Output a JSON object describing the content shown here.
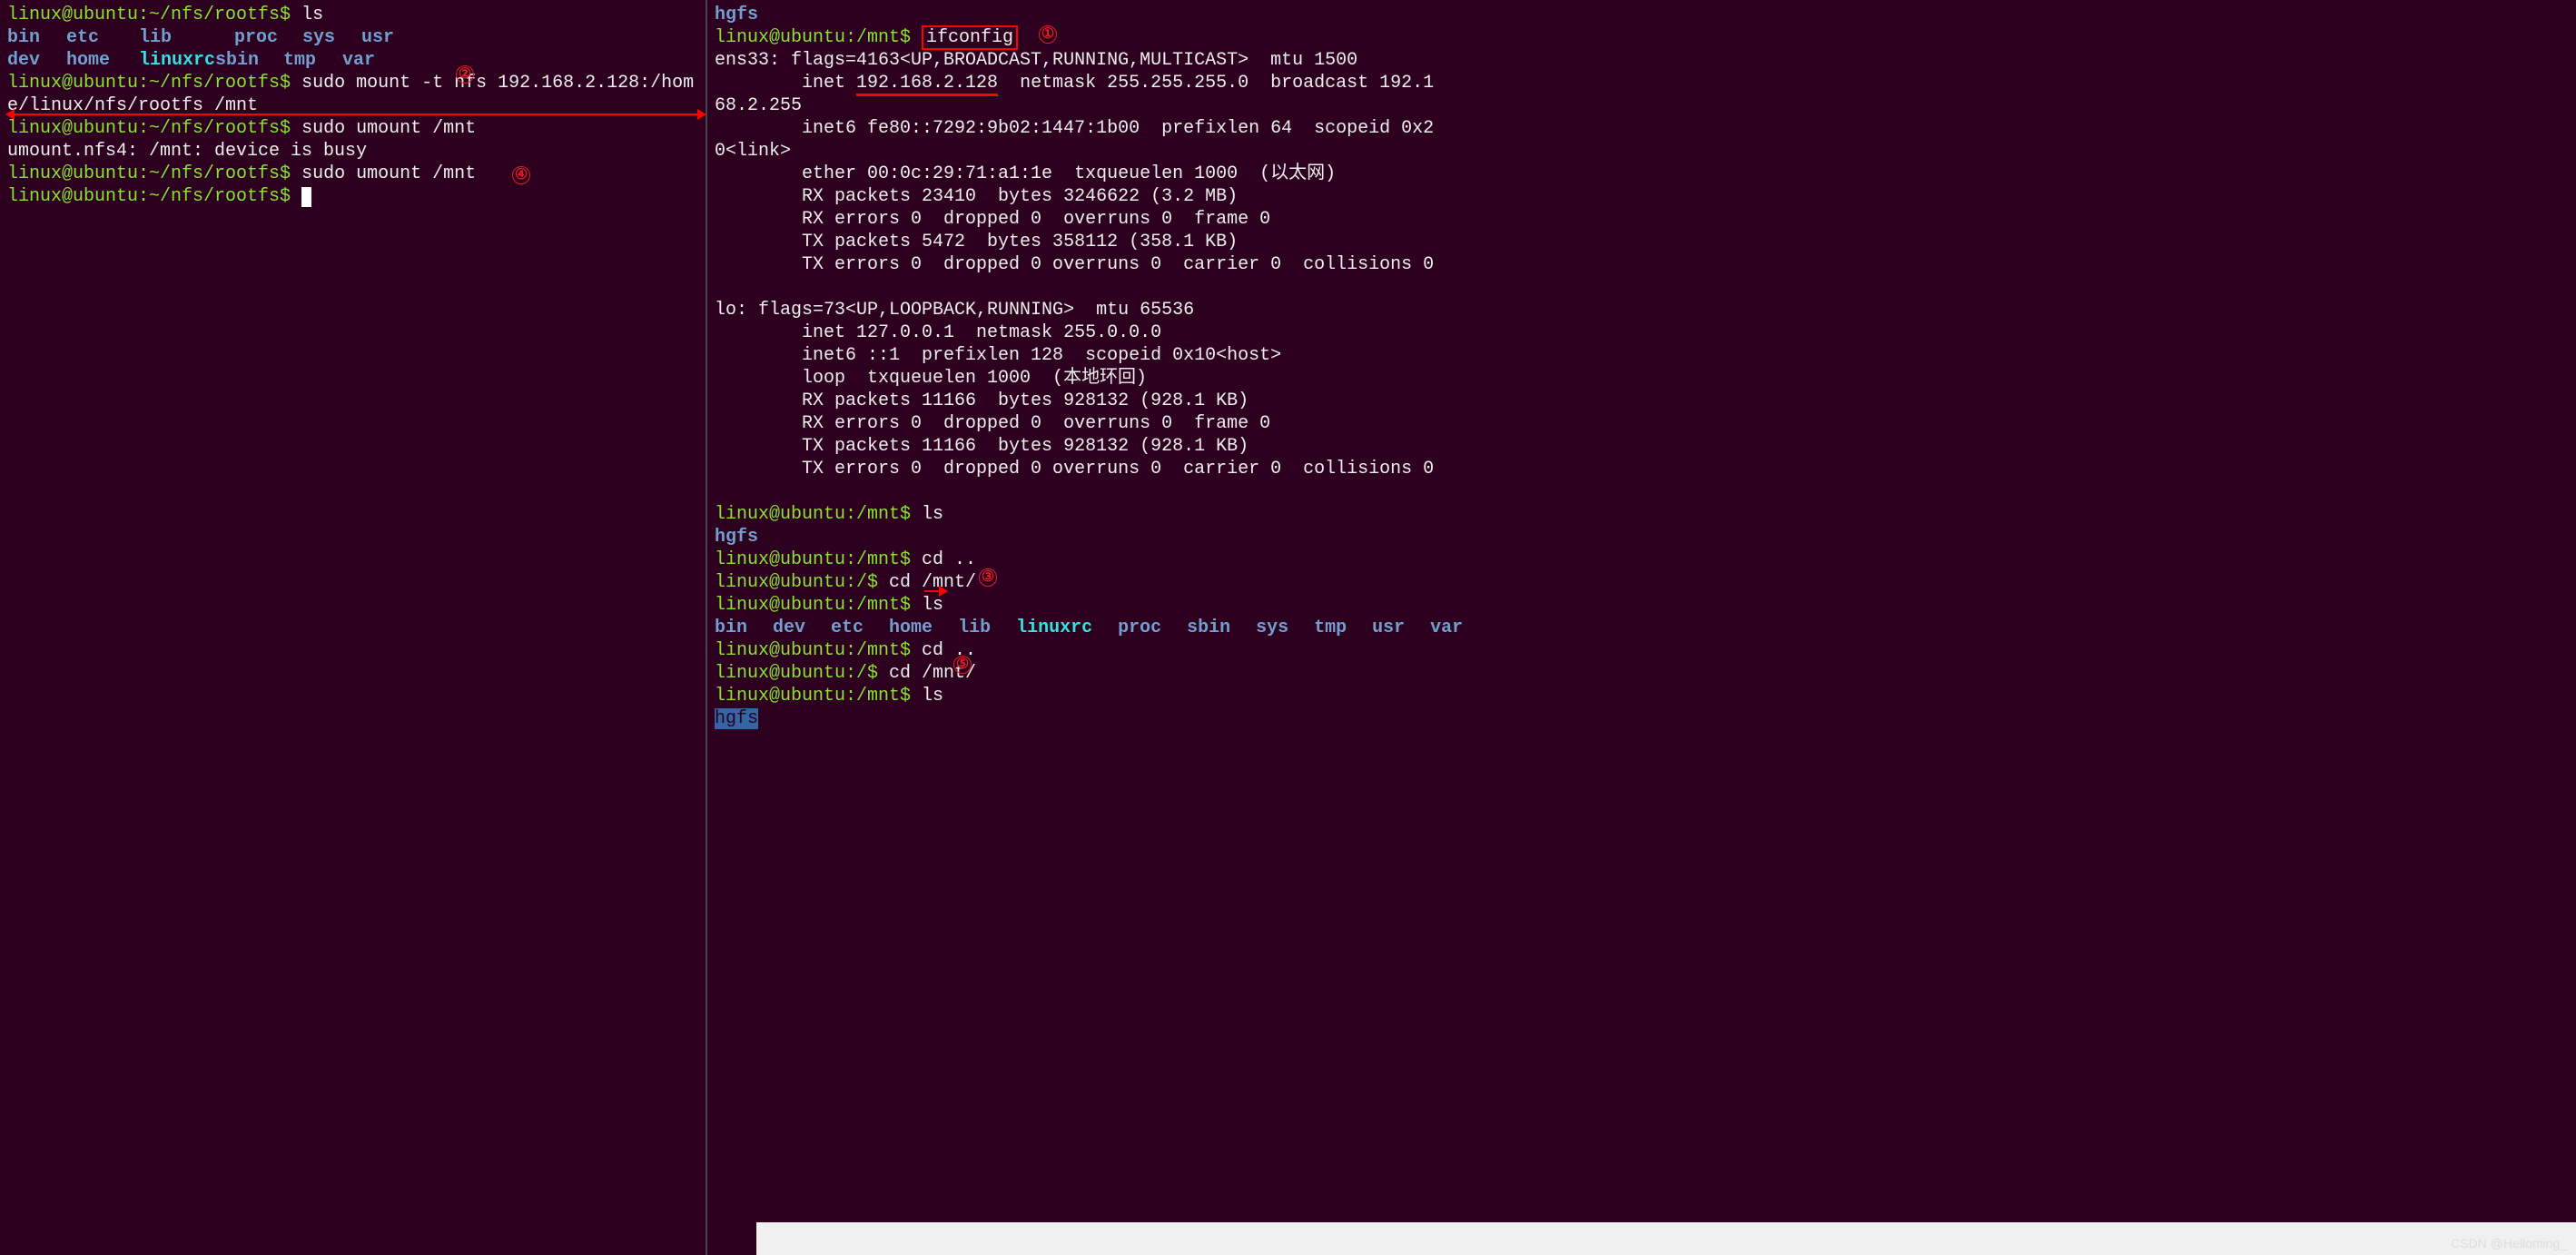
{
  "left": {
    "prompt1": "linux@ubuntu:~/nfs/rootfs$ ",
    "cmd_ls": "ls",
    "ls_rows": [
      [
        "bin",
        "etc",
        "lib",
        "",
        "proc",
        "sys",
        "usr"
      ],
      [
        "dev",
        "home",
        "linuxrc",
        "sbin",
        "tmp",
        "var"
      ]
    ],
    "cmd_mount_part1": "sudo mount -t nfs 192.168.2.128:/hom",
    "cmd_mount_wrap": "e/linux/nfs/rootfs /mnt",
    "cmd_umount1": "sudo umount /mnt",
    "err_busy": "umount.nfs4: /mnt: device is busy",
    "cmd_umount2": "sudo umount /mnt"
  },
  "right": {
    "hgfs": "hgfs",
    "prompt_mnt": "linux@ubuntu:/mnt$ ",
    "prompt_root": "linux@ubuntu:/$ ",
    "cmd_ifconfig": "ifconfig",
    "ens33_header": "ens33: flags=4163<UP,BROADCAST,RUNNING,MULTICAST>  mtu 1500",
    "inet_prefix": "        inet ",
    "inet_ip": "192.168.2.128",
    "inet_rest": "  netmask 255.255.255.0  broadcast 192.1",
    "inet_wrap": "68.2.255",
    "inet6_1": "        inet6 fe80::7292:9b02:1447:1b00  prefixlen 64  scopeid 0x2",
    "inet6_wrap": "0<link>",
    "ether": "        ether 00:0c:29:71:a1:1e  txqueuelen 1000  (以太网)",
    "rx_packets1": "        RX packets 23410  bytes 3246622 (3.2 MB)",
    "rx_errors1": "        RX errors 0  dropped 0  overruns 0  frame 0",
    "tx_packets1": "        TX packets 5472  bytes 358112 (358.1 KB)",
    "tx_errors1": "        TX errors 0  dropped 0 overruns 0  carrier 0  collisions 0",
    "lo_header": "lo: flags=73<UP,LOOPBACK,RUNNING>  mtu 65536",
    "lo_inet": "        inet 127.0.0.1  netmask 255.0.0.0",
    "lo_inet6": "        inet6 ::1  prefixlen 128  scopeid 0x10<host>",
    "lo_loop": "        loop  txqueuelen 1000  (本地环回)",
    "lo_rx_packets": "        RX packets 11166  bytes 928132 (928.1 KB)",
    "lo_rx_errors": "        RX errors 0  dropped 0  overruns 0  frame 0",
    "lo_tx_packets": "        TX packets 11166  bytes 928132 (928.1 KB)",
    "lo_tx_errors": "        TX errors 0  dropped 0 overruns 0  carrier 0  collisions 0",
    "cmd_ls": "ls",
    "cmd_cdup": "cd ..",
    "cmd_cdmnt": "cd /mnt/",
    "ls_dirs": [
      "bin",
      "dev",
      "etc",
      "home",
      "lib",
      "linuxrc",
      "proc",
      "sbin",
      "sys",
      "tmp",
      "usr",
      "var"
    ]
  },
  "annotations": {
    "n1": "①",
    "n2": "②",
    "n3": "③",
    "n4": "④",
    "n5": "⑤"
  },
  "watermark": "CSDN @Helloming_"
}
